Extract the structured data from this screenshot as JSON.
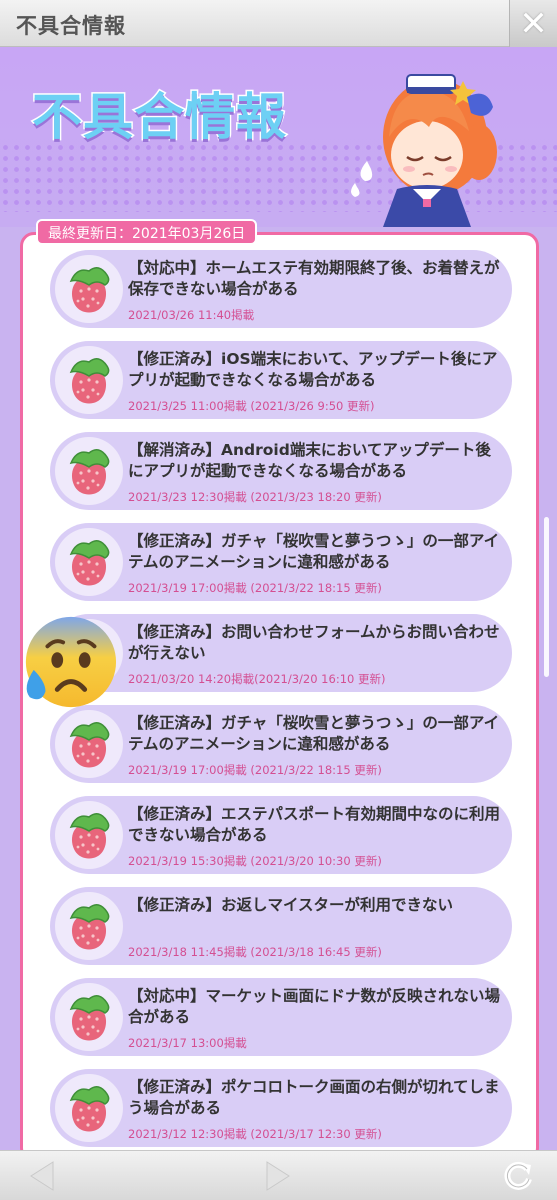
{
  "window": {
    "title": "不具合情報",
    "close_icon": "close-icon"
  },
  "header": {
    "title": "不具合情報"
  },
  "last_updated": "最終更新日：2021年03月26日",
  "items": [
    {
      "title": "【対応中】ホームエステ有効期限終了後、お着替えが保存できない場合がある",
      "date": "2021/03/26 11:40掲載"
    },
    {
      "title": "【修正済み】iOS端末において、アップデート後にアプリが起動できなくなる場合がある",
      "date": "2021/3/25 11:00掲載 (2021/3/26 9:50 更新)"
    },
    {
      "title": "【解消済み】Android端末においてアップデート後にアプリが起動できなくなる場合がある",
      "date": "2021/3/23 12:30掲載 (2021/3/23 18:20 更新)"
    },
    {
      "title": "【修正済み】ガチャ「桜吹雪と夢うつゝ」の一部アイテムのアニメーションに違和感がある",
      "date": "2021/3/19 17:00掲載 (2021/3/22 18:15 更新)"
    },
    {
      "title": "【修正済み】お問い合わせフォームからお問い合わせが行えない",
      "date": "2021/03/20 14:20掲載(2021/3/20 16:10 更新)"
    },
    {
      "title": "【修正済み】ガチャ「桜吹雪と夢うつゝ」の一部アイテムのアニメーションに違和感がある",
      "date": "2021/3/19 17:00掲載 (2021/3/22 18:15 更新)"
    },
    {
      "title": "【修正済み】エステパスポート有効期間中なのに利用できない場合がある",
      "date": "2021/3/19 15:30掲載 (2021/3/20 10:30 更新)"
    },
    {
      "title": "【修正済み】お返しマイスターが利用できない",
      "date": "2021/3/18 11:45掲載 (2021/3/18 16:45 更新)"
    },
    {
      "title": "【対応中】マーケット画面にドナ数が反映されない場合がある",
      "date": "2021/3/17 13:00掲載"
    },
    {
      "title": "【修正済み】ポケコロトーク画面の右側が切れてしまう場合がある",
      "date": "2021/3/12 12:30掲載 (2021/3/17 12:30 更新)"
    }
  ],
  "toolbar": {
    "back_icon": "back-arrow-icon",
    "forward_icon": "forward-arrow-icon",
    "reload_icon": "reload-icon"
  },
  "colors": {
    "accent": "#f06aa4",
    "date": "#d44f92",
    "item_bg": "#d9cdf6",
    "title_blue": "#6dd0f4"
  }
}
